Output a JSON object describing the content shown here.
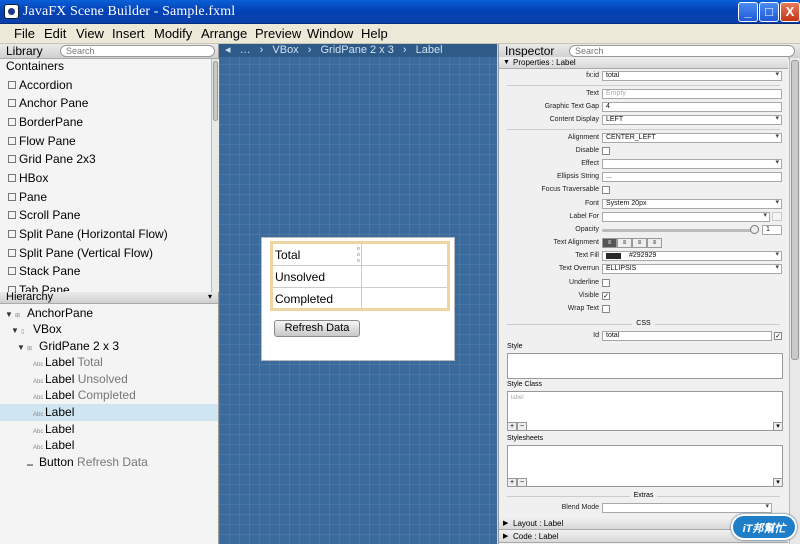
{
  "window": {
    "title": "JavaFX Scene Builder - Sample.fxml",
    "min": "_",
    "max": "□",
    "close": "X"
  },
  "menu": [
    "File",
    "Edit",
    "View",
    "Insert",
    "Modify",
    "Arrange",
    "Preview",
    "Window",
    "Help"
  ],
  "library": {
    "title": "Library",
    "search_placeholder": "Search",
    "section": "Containers",
    "items": [
      "Accordion",
      "Anchor Pane",
      "BorderPane",
      "Flow Pane",
      "Grid Pane 2x3",
      "HBox",
      "Pane",
      "Scroll Pane",
      "Split Pane (Horizontal Flow)",
      "Split Pane (Vertical Flow)",
      "Stack Pane",
      "Tab Pane"
    ]
  },
  "hierarchy": {
    "title": "Hierarchy",
    "rows": [
      {
        "kind": "AnchorPane",
        "extra": ""
      },
      {
        "kind": "VBox",
        "extra": ""
      },
      {
        "kind": "GridPane 2 x 3",
        "extra": ""
      },
      {
        "kind": "Label",
        "extra": "Total"
      },
      {
        "kind": "Label",
        "extra": "Unsolved"
      },
      {
        "kind": "Label",
        "extra": "Completed"
      },
      {
        "kind": "Label",
        "extra": ""
      },
      {
        "kind": "Label",
        "extra": ""
      },
      {
        "kind": "Label",
        "extra": ""
      },
      {
        "kind": "Button",
        "extra": "Refresh Data"
      }
    ],
    "icon_text": "Abc"
  },
  "breadcrumb": [
    "…",
    "VBox",
    "GridPane 2 x 3",
    "Label"
  ],
  "canvas": {
    "labels": [
      "Total",
      "Unsolved",
      "Completed"
    ],
    "button": "Refresh Data"
  },
  "inspector": {
    "title": "Inspector",
    "search_placeholder": "Search",
    "section": "Properties : Label",
    "props": {
      "fx_id": {
        "label": "fx:id",
        "value": "total"
      },
      "text": {
        "label": "Text",
        "value": "Empty"
      },
      "gap": {
        "label": "Graphic Text Gap",
        "value": "4"
      },
      "content_display": {
        "label": "Content Display",
        "value": "LEFT"
      },
      "alignment": {
        "label": "Alignment",
        "value": "CENTER_LEFT"
      },
      "disable": {
        "label": "Disable"
      },
      "effect": {
        "label": "Effect"
      },
      "ellipsis": {
        "label": "Ellipsis String",
        "value": "..."
      },
      "focus": {
        "label": "Focus Traversable"
      },
      "font": {
        "label": "Font",
        "value": "System 20px"
      },
      "label_for": {
        "label": "Label For"
      },
      "opacity": {
        "label": "Opacity",
        "value": "1"
      },
      "text_align": {
        "label": "Text Alignment"
      },
      "text_fill": {
        "label": "Text Fill",
        "value": "#292929"
      },
      "overrun": {
        "label": "Text Overrun",
        "value": "ELLIPSIS"
      },
      "underline": {
        "label": "Underline"
      },
      "visible": {
        "label": "Visible"
      },
      "wrap": {
        "label": "Wrap Text"
      }
    },
    "css": {
      "header": "CSS",
      "id_label": "Id",
      "id_value": "total",
      "style": "Style",
      "style_class": "Style Class",
      "style_class_value": "label",
      "stylesheets": "Stylesheets"
    },
    "extras": {
      "header": "Extras",
      "blend_label": "Blend Mode"
    },
    "layout_section": "Layout : Label",
    "code_section": "Code : Label",
    "text_fill_color": "#292929"
  },
  "watermark": "iT邦幫忙"
}
